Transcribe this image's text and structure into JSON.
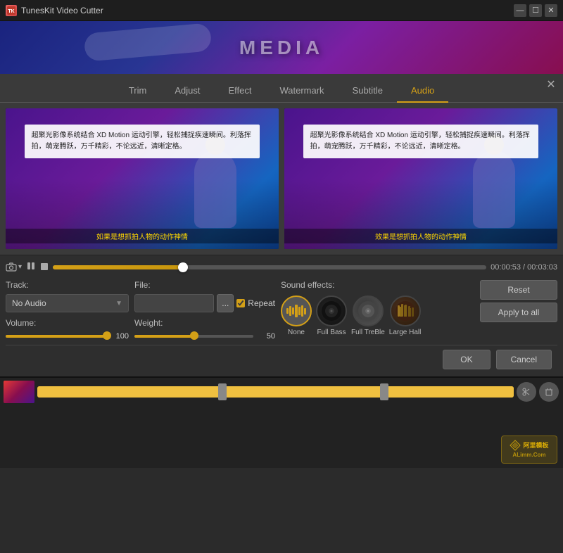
{
  "app": {
    "title": "TunesKit Video Cutter",
    "icon_label": "TK"
  },
  "title_bar": {
    "minimize": "—",
    "maximize": "☐",
    "close": "✕"
  },
  "panel_close": "✕",
  "tabs": {
    "items": [
      "Trim",
      "Adjust",
      "Effect",
      "Watermark",
      "Subtitle",
      "Audio"
    ],
    "active_index": 5
  },
  "video_panels": {
    "left": {
      "text_card": "超聚光影像系统结合 XD Motion 运动引擎，轻松捕捉疾速瞬间。利落挥拍，萌宠腾跃，万千精彩，不论远近，清晰定格。",
      "subtitle": "如果是想抓拍人物的动作神情"
    },
    "right": {
      "text_card": "超聚光影像系统结合 XD Motion 运动引擎，轻松捕捉疾速瞬间。利落挥拍，萌宠腾跃，万千精彩，不论远近，清晰定格。",
      "subtitle": "效果是想抓拍人物的动作神情"
    }
  },
  "timeline": {
    "current_time": "00:00:53",
    "total_time": "00:03:03",
    "time_separator": " / ",
    "fill_percent": 30
  },
  "audio_track": {
    "label": "Track:",
    "value": "No Audio"
  },
  "audio_file": {
    "label": "File:",
    "browse_btn": "...",
    "repeat_label": "Repeat",
    "repeat_checked": true
  },
  "audio_volume": {
    "label": "Volume:",
    "value": "100"
  },
  "audio_weight": {
    "label": "Weight:",
    "value": "50"
  },
  "sound_effects": {
    "label": "Sound effects:",
    "items": [
      {
        "name": "None",
        "icon": "waveform"
      },
      {
        "name": "Full Bass",
        "icon": "bass"
      },
      {
        "name": "Full TreBle",
        "icon": "treble"
      },
      {
        "name": "Large Hall",
        "icon": "hall"
      }
    ],
    "selected_index": 0
  },
  "action_buttons": {
    "reset": "Reset",
    "apply_to_all": "Apply to all"
  },
  "bottom_buttons": {
    "ok": "OK",
    "cancel": "Cancel"
  },
  "watermark": {
    "text": "阿里模板\nALimm.Com"
  }
}
